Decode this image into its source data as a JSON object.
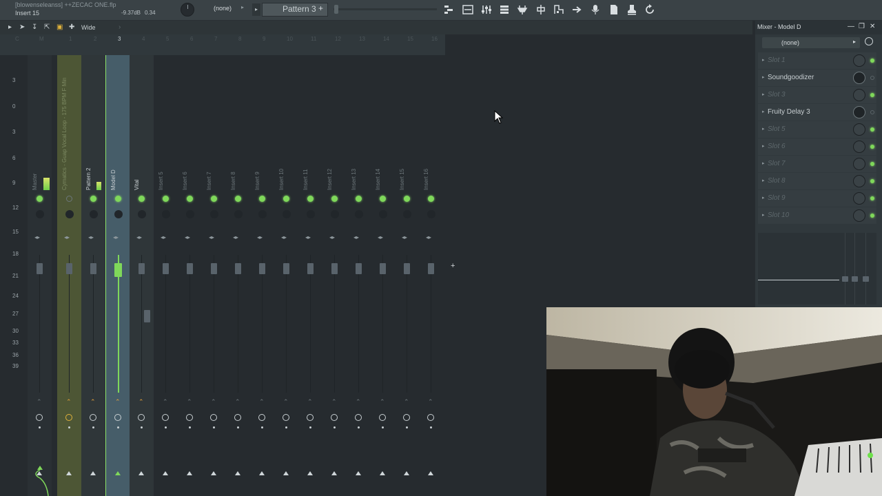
{
  "topbar": {
    "project_title": "[blowenseleanss] ++ZECAC ONE.flp",
    "insert_label": "Insert 15",
    "volume_db": "-9.37dB",
    "pan_value": "0.34",
    "none_label": "(none)",
    "pattern_label": "Pattern 3",
    "pattern_plus": "+",
    "icons": [
      "piano-roll-icon",
      "playlist-icon",
      "mixer-icon",
      "channel-rack-icon",
      "plugin-picker-icon",
      "browser-icon",
      "tempo-icon",
      "arrow-icon",
      "mic-icon",
      "file-icon",
      "stamp-icon",
      "refresh-icon"
    ]
  },
  "mixbar": {
    "wide_label": "Wide"
  },
  "scale_labels": [
    "3",
    "0",
    "3",
    "6",
    "9",
    "12",
    "15",
    "18",
    "21",
    "24",
    "27",
    "30",
    "33",
    "36",
    "39"
  ],
  "track_numbers": [
    "C",
    "M",
    "1",
    "2",
    "3",
    "4",
    "5",
    "6",
    "7",
    "8",
    "9",
    "10",
    "11",
    "12",
    "13",
    "14",
    "15",
    "16"
  ],
  "channels": [
    {
      "name": "Master",
      "bg": "#2a3034"
    },
    {
      "name": "Cymatics - Guap Vocal Loop - 175 BPM F Min",
      "bg": "#4d5635"
    },
    {
      "name": "Pattern 2",
      "bg": "#2f3639"
    },
    {
      "name": "Model D",
      "bg": "#465d69"
    },
    {
      "name": "Vital",
      "bg": "#2f3639"
    },
    {
      "name": "Insert 5",
      "bg": "#262b2f"
    },
    {
      "name": "Insert 6",
      "bg": "#262b2f"
    },
    {
      "name": "Insert 7",
      "bg": "#262b2f"
    },
    {
      "name": "Insert 8",
      "bg": "#262b2f"
    },
    {
      "name": "Insert 9",
      "bg": "#262b2f"
    },
    {
      "name": "Insert 10",
      "bg": "#262b2f"
    },
    {
      "name": "Insert 11",
      "bg": "#262b2f"
    },
    {
      "name": "Insert 12",
      "bg": "#262b2f"
    },
    {
      "name": "Insert 13",
      "bg": "#262b2f"
    },
    {
      "name": "Insert 14",
      "bg": "#262b2f"
    },
    {
      "name": "Insert 15",
      "bg": "#262b2f"
    },
    {
      "name": "Insert 16",
      "bg": "#262b2f"
    }
  ],
  "panel": {
    "title": "Mixer - Model D",
    "none_label": "(none)",
    "slots": [
      {
        "label": "Slot 1",
        "active": false,
        "led_on": true
      },
      {
        "label": "Soundgoodizer",
        "active": true,
        "led_on": false
      },
      {
        "label": "Slot 3",
        "active": false,
        "led_on": true
      },
      {
        "label": "Fruity Delay 3",
        "active": true,
        "led_on": false
      },
      {
        "label": "Slot 5",
        "active": false,
        "led_on": true
      },
      {
        "label": "Slot 6",
        "active": false,
        "led_on": true
      },
      {
        "label": "Slot 7",
        "active": false,
        "led_on": true
      },
      {
        "label": "Slot 8",
        "active": false,
        "led_on": true
      },
      {
        "label": "Slot 9",
        "active": false,
        "led_on": true
      },
      {
        "label": "Slot 10",
        "active": false,
        "led_on": true
      }
    ]
  },
  "colors": {
    "accent_green": "#7fd85a",
    "selected_channel": "#465d69",
    "highlighted_channel": "#4d5635"
  }
}
